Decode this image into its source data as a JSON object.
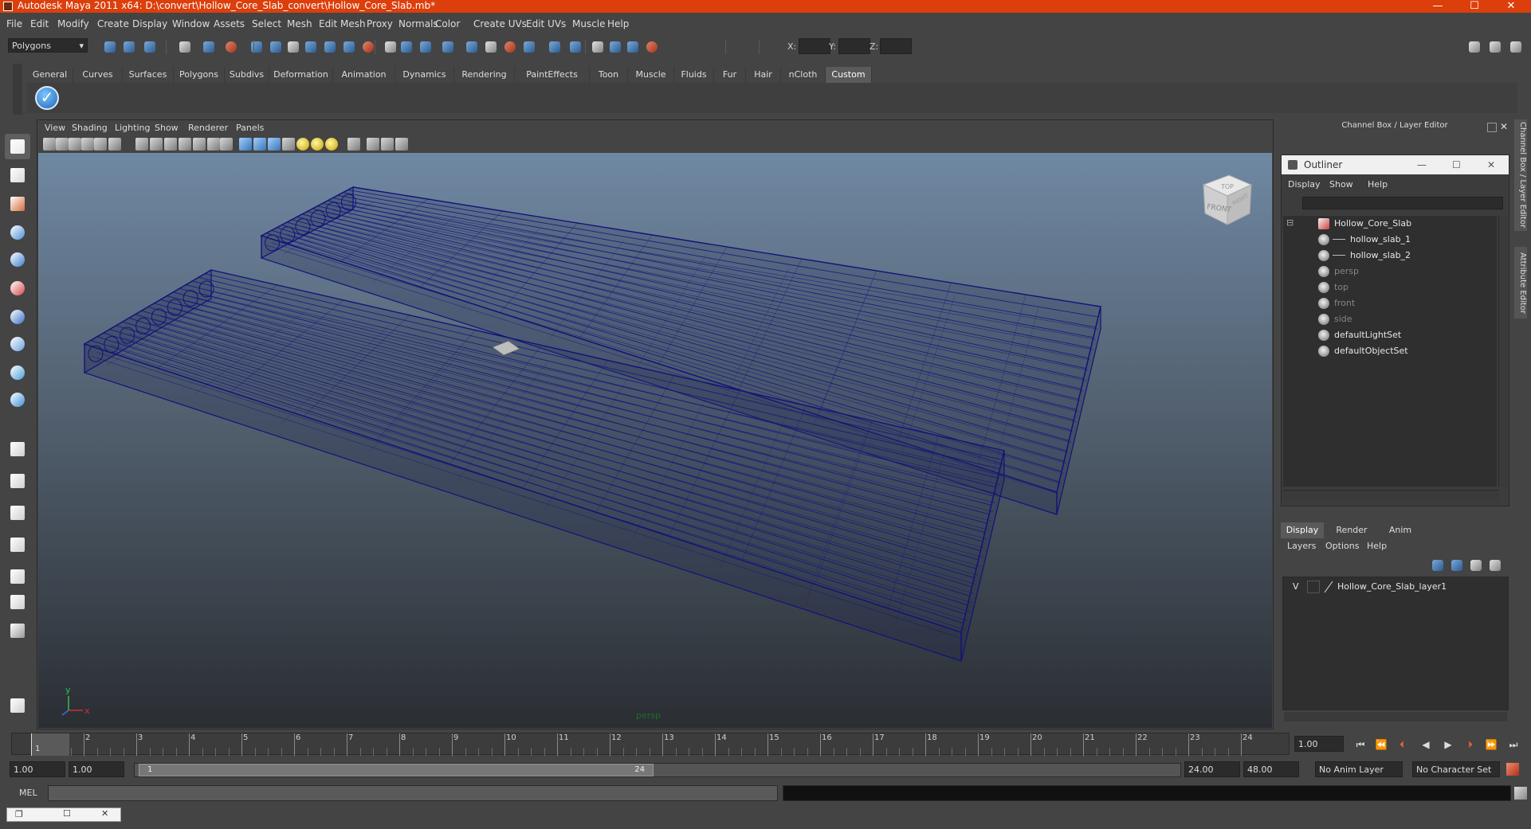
{
  "window": {
    "title": "Autodesk Maya 2011 x64: D:\\convert\\Hollow_Core_Slab_convert\\Hollow_Core_Slab.mb*",
    "controls": [
      "minimize",
      "maximize",
      "close"
    ]
  },
  "menubar": [
    "File",
    "Edit",
    "Modify",
    "Create",
    "Display",
    "Window",
    "Assets",
    "Select",
    "Mesh",
    "Edit Mesh",
    "Proxy",
    "Normals",
    "Color",
    "Create UVs",
    "Edit UVs",
    "Muscle",
    "Help"
  ],
  "statusline": {
    "mode": "Polygons",
    "coord_labels": [
      "X:",
      "Y:",
      "Z:"
    ]
  },
  "shelf": {
    "tabs": [
      "General",
      "Curves",
      "Surfaces",
      "Polygons",
      "Subdivs",
      "Deformation",
      "Animation",
      "Dynamics",
      "Rendering",
      "PaintEffects",
      "Toon",
      "Muscle",
      "Fluids",
      "Fur",
      "Hair",
      "nCloth",
      "Custom"
    ],
    "active_tab": "Custom",
    "button_icon": "checkmark-icon"
  },
  "toolbox": {
    "tools": [
      "select-tool-icon",
      "lasso-tool-icon",
      "paint-select-icon",
      "sculpt-tool-icon",
      "move-tool-icon",
      "rotate-tool-icon",
      "scale-tool-icon",
      "universal-manip-icon",
      "soft-mod-icon",
      "show-manip-icon",
      "single-view-layout-icon",
      "four-view-layout-icon",
      "outliner-layout-icon",
      "graph-layout-icon",
      "hypershade-layout-icon",
      "uv-layout-icon",
      "more-layouts-icon",
      "help-icon"
    ]
  },
  "viewport": {
    "menus": [
      "View",
      "Shading",
      "Lighting",
      "Show",
      "Renderer",
      "Panels"
    ],
    "camera_label": "persp",
    "viewcube": {
      "top": "TOP",
      "front": "FRONT",
      "side": "RIGHT"
    },
    "axis": {
      "x": "x",
      "y": "y"
    },
    "wire_color": "#12127a"
  },
  "rightpanel": {
    "title": "Channel Box / Layer Editor",
    "side_tabs": [
      "Channel Box / Layer Editor",
      "Attribute Editor"
    ]
  },
  "outliner": {
    "title": "Outliner",
    "menus": [
      "Display",
      "Show",
      "Help"
    ],
    "items": [
      {
        "label": "Hollow_Core_Slab",
        "indent": 0,
        "dim": false,
        "icon": "transform-group-icon"
      },
      {
        "label": "hollow_slab_1",
        "indent": 1,
        "dim": false,
        "icon": "mesh-icon"
      },
      {
        "label": "hollow_slab_2",
        "indent": 1,
        "dim": false,
        "icon": "mesh-icon"
      },
      {
        "label": "persp",
        "indent": 0,
        "dim": true,
        "icon": "camera-icon"
      },
      {
        "label": "top",
        "indent": 0,
        "dim": true,
        "icon": "camera-icon"
      },
      {
        "label": "front",
        "indent": 0,
        "dim": true,
        "icon": "camera-icon"
      },
      {
        "label": "side",
        "indent": 0,
        "dim": true,
        "icon": "camera-icon"
      },
      {
        "label": "defaultLightSet",
        "indent": 0,
        "dim": false,
        "icon": "set-icon"
      },
      {
        "label": "defaultObjectSet",
        "indent": 0,
        "dim": false,
        "icon": "set-icon"
      }
    ]
  },
  "layer_editor": {
    "tabs": [
      "Display",
      "Render",
      "Anim"
    ],
    "active_tab": "Display",
    "menus": [
      "Layers",
      "Options",
      "Help"
    ],
    "layers": [
      {
        "visible": "V",
        "name": "Hollow_Core_Slab_layer1"
      }
    ]
  },
  "timeline": {
    "ticks": [
      "1",
      "2",
      "3",
      "4",
      "5",
      "6",
      "7",
      "8",
      "9",
      "10",
      "11",
      "12",
      "13",
      "14",
      "15",
      "16",
      "17",
      "18",
      "19",
      "20",
      "21",
      "22",
      "23",
      "24"
    ],
    "current_marker": "1",
    "current_frame": "1.00",
    "playback_buttons": [
      "go-to-start-icon",
      "step-back-key-icon",
      "step-back-frame-icon",
      "play-back-icon",
      "play-forward-icon",
      "step-forward-frame-icon",
      "step-forward-key-icon",
      "go-to-end-icon"
    ]
  },
  "range": {
    "start": "1.00",
    "playback_start": "1.00",
    "handle_start": "1",
    "handle_end": "24",
    "playback_end": "24.00",
    "end": "48.00",
    "anim_layer": "No Anim Layer",
    "character_set": "No Character Set"
  },
  "commandline": {
    "label": "MEL"
  }
}
